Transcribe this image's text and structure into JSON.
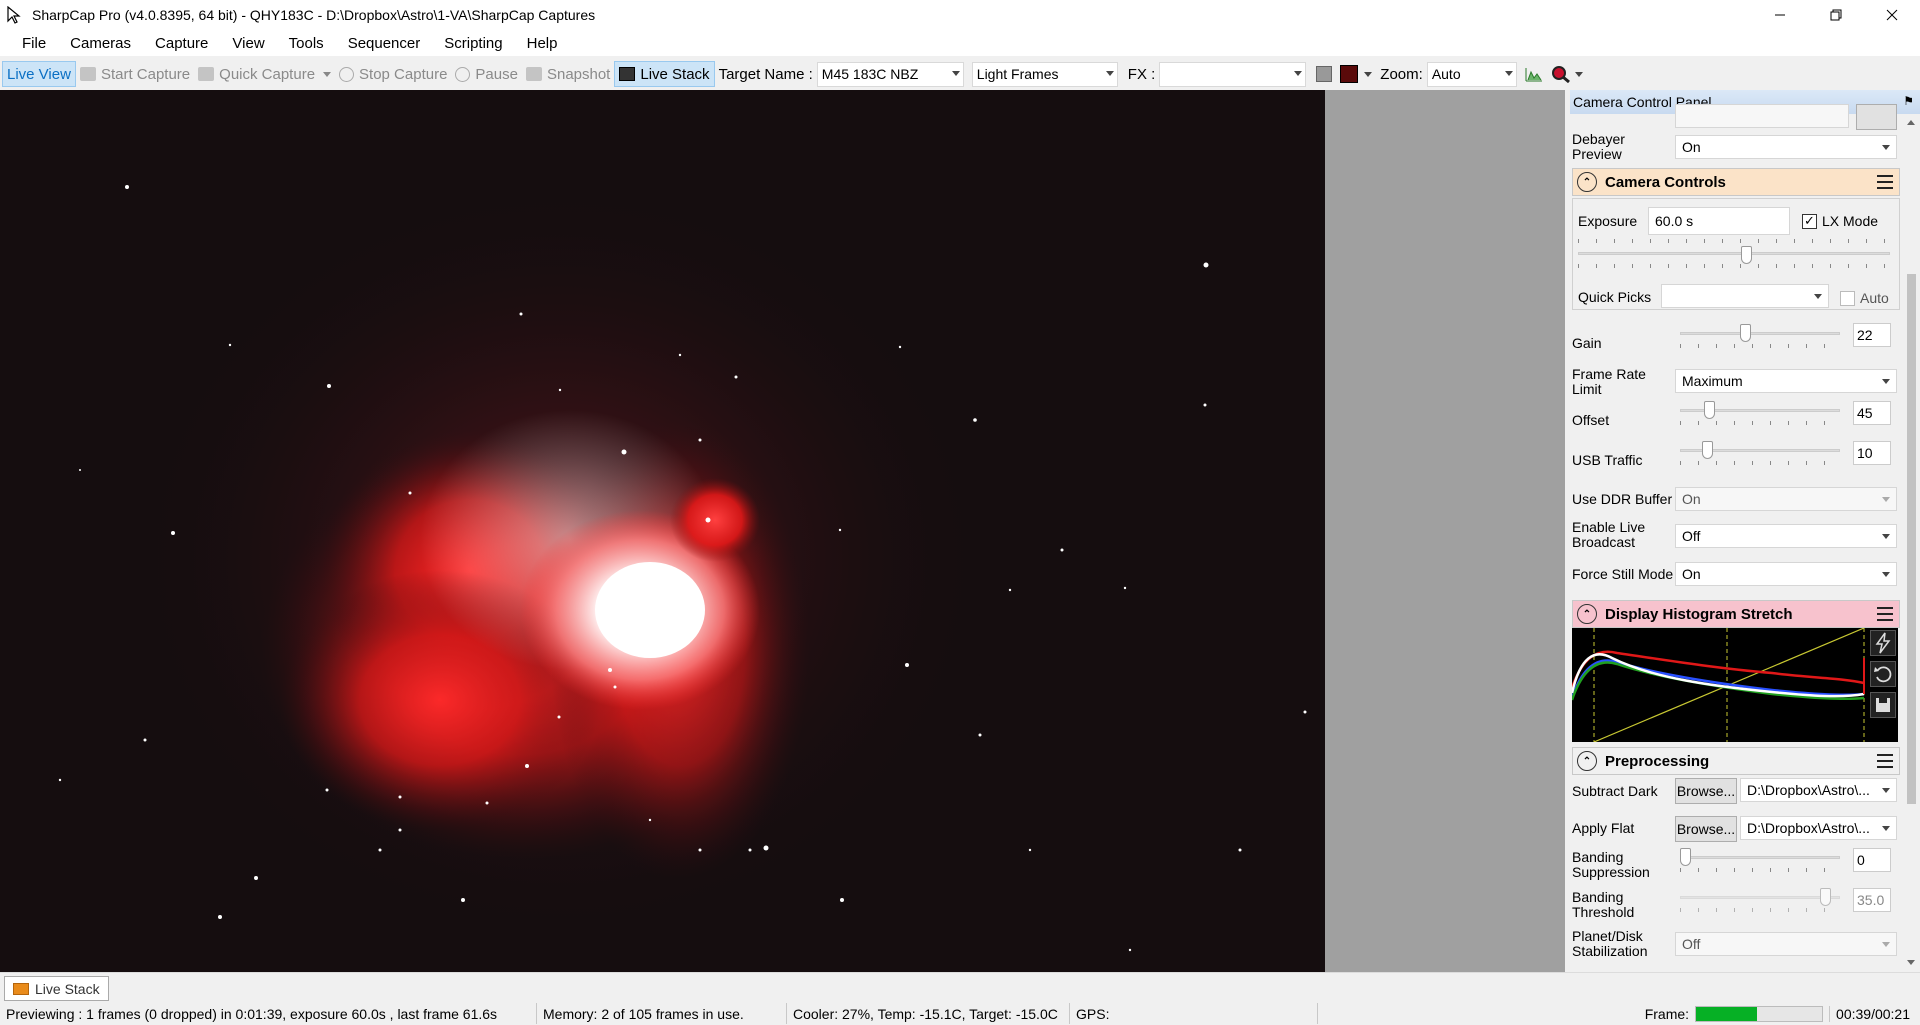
{
  "window": {
    "title": "SharpCap Pro (v4.0.8395, 64 bit) - QHY183C - D:\\Dropbox\\Astro\\1-VA\\SharpCap Captures",
    "minimize_icon": "minimize-icon",
    "maximize_icon": "restore-icon",
    "close_icon": "close-icon"
  },
  "menu": [
    "File",
    "Cameras",
    "Capture",
    "View",
    "Tools",
    "Sequencer",
    "Scripting",
    "Help"
  ],
  "toolbar": {
    "live_view": "Live View",
    "start_capture": "Start Capture",
    "quick_capture": "Quick Capture",
    "stop_capture": "Stop Capture",
    "pause": "Pause",
    "snapshot": "Snapshot",
    "live_stack": "Live Stack",
    "target_name_label": "Target Name :",
    "target_name_value": "M45 183C NBZ",
    "frame_type": "Light Frames",
    "fx_label": "FX :",
    "fx_value": "",
    "zoom_label": "Zoom:",
    "zoom_value": "Auto"
  },
  "panel": {
    "title": "Camera Control Panel",
    "debayer_label": "Debayer Preview",
    "debayer_value": "On",
    "camera_controls": {
      "title": "Camera Controls",
      "exposure_label": "Exposure",
      "exposure_value": "60.0 s",
      "lx_mode_label": "LX Mode",
      "lx_mode_checked": true,
      "exposure_slider": 0.48,
      "quick_picks_label": "Quick Picks",
      "quick_picks_value": "",
      "auto_label": "Auto",
      "gain_label": "Gain",
      "gain_value": "22",
      "frame_rate_label": "Frame Rate Limit",
      "frame_rate_value": "Maximum",
      "offset_label": "Offset",
      "offset_value": "45",
      "usb_label": "USB Traffic",
      "usb_value": "10",
      "ddr_label": "Use DDR Buffer",
      "ddr_value": "On",
      "broadcast_label": "Enable Live Broadcast",
      "broadcast_value": "Off",
      "force_still_label": "Force Still Mode",
      "force_still_value": "On"
    },
    "histogram": {
      "title": "Display Histogram Stretch",
      "colors": {
        "red": "#e01818",
        "white": "#ffffff",
        "blue": "#2850ff",
        "green": "#20a020",
        "line": "#c8c832"
      }
    },
    "preprocessing": {
      "title": "Preprocessing",
      "subtract_dark_label": "Subtract Dark",
      "subtract_dark_button": "Browse...",
      "subtract_dark_value": "D:\\Dropbox\\Astro\\...",
      "apply_flat_label": "Apply Flat",
      "apply_flat_button": "Browse...",
      "apply_flat_value": "D:\\Dropbox\\Astro\\...",
      "banding_suppression_label": "Banding Suppression",
      "banding_suppression_value": "0",
      "banding_threshold_label": "Banding Threshold",
      "banding_threshold_value": "35.0",
      "stabilization_label": "Planet/Disk Stabilization",
      "stabilization_value": "Off"
    }
  },
  "tabs": {
    "live_stack": "Live Stack"
  },
  "status": {
    "preview": "Previewing : 1 frames (0 dropped) in 0:01:39, exposure 60.0s , last frame 61.6s",
    "memory": "Memory: 2 of 105 frames in use.",
    "cooler": "Cooler: 27%, Temp: -15.1C, Target: -15.0C",
    "gps": "GPS:",
    "frame_label": "Frame:",
    "frame_progress": 0.48,
    "elapsed": "00:39/00:21"
  }
}
